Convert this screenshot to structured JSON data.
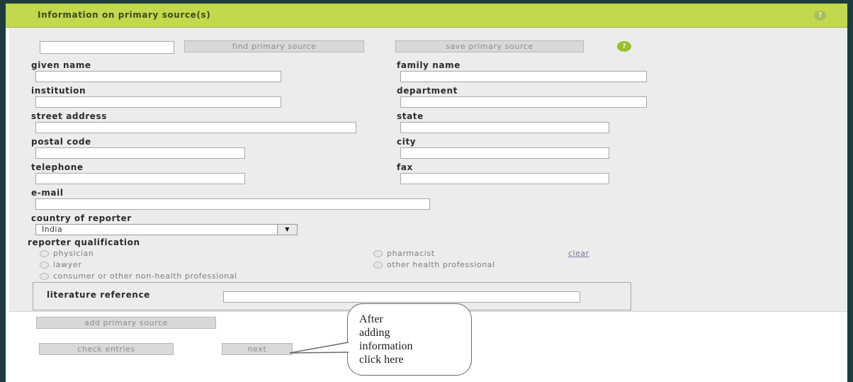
{
  "panel": {
    "title": "Information on primary source(s)",
    "help_icon": "question-icon"
  },
  "search": {
    "value": "",
    "find_label": "find primary source",
    "save_label": "save primary source"
  },
  "fields": {
    "given_name": {
      "label": "given name",
      "value": ""
    },
    "family_name": {
      "label": "family name",
      "value": ""
    },
    "institution": {
      "label": "institution",
      "value": ""
    },
    "department": {
      "label": "department",
      "value": ""
    },
    "street_address": {
      "label": "street address",
      "value": ""
    },
    "state": {
      "label": "state",
      "value": ""
    },
    "postal_code": {
      "label": "postal code",
      "value": ""
    },
    "city": {
      "label": "city",
      "value": ""
    },
    "telephone": {
      "label": "telephone",
      "value": ""
    },
    "fax": {
      "label": "fax",
      "value": ""
    },
    "email": {
      "label": "e-mail",
      "value": ""
    }
  },
  "country": {
    "label": "country of reporter",
    "selected": "India"
  },
  "qualification": {
    "label": "reporter qualification",
    "options": [
      "physician",
      "pharmacist",
      "lawyer",
      "other health professional",
      "consumer or other non-health professional"
    ],
    "clear_label": "clear"
  },
  "literature": {
    "label": "literature reference",
    "value": ""
  },
  "actions": {
    "add_label": "add primary source",
    "check_label": "check entries",
    "next_label": "next"
  },
  "callout": {
    "text": "After\nadding\ninformation\nclick here"
  },
  "colors": {
    "header": "#c3d84d",
    "panel": "#ececec",
    "frame": "#1f3b3d",
    "help": "#99c02e"
  }
}
